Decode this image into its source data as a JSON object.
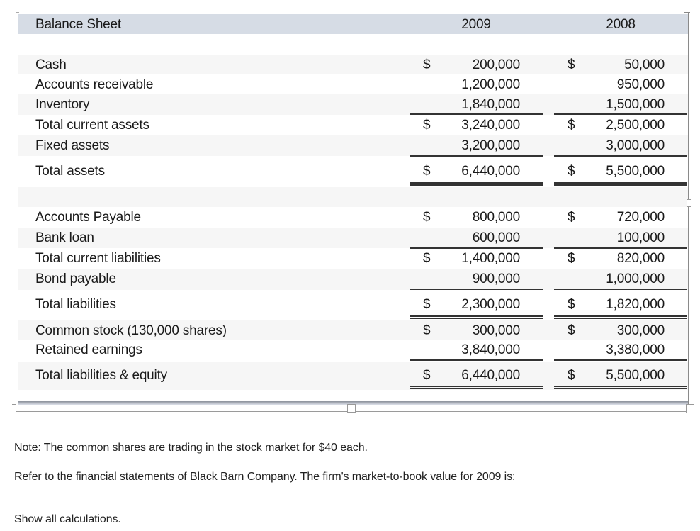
{
  "balance_sheet": {
    "title": "Balance Sheet",
    "years": [
      "2009",
      "2008"
    ],
    "assets": [
      {
        "label": "Cash",
        "y2009": {
          "dollar": "$",
          "value": "200,000"
        },
        "y2008": {
          "dollar": "$",
          "value": "50,000"
        }
      },
      {
        "label": "Accounts receivable",
        "y2009": {
          "dollar": "",
          "value": "1,200,000"
        },
        "y2008": {
          "dollar": "",
          "value": "950,000"
        }
      },
      {
        "label": "Inventory",
        "y2009": {
          "dollar": "",
          "value": "1,840,000"
        },
        "y2008": {
          "dollar": "",
          "value": "1,500,000"
        }
      },
      {
        "label": "Total current assets",
        "y2009": {
          "dollar": "$",
          "value": "3,240,000"
        },
        "y2008": {
          "dollar": "$",
          "value": "2,500,000"
        }
      },
      {
        "label": "Fixed assets",
        "y2009": {
          "dollar": "",
          "value": "3,200,000"
        },
        "y2008": {
          "dollar": "",
          "value": "3,000,000"
        }
      },
      {
        "label": "Total assets",
        "y2009": {
          "dollar": "$",
          "value": "6,440,000"
        },
        "y2008": {
          "dollar": "$",
          "value": "5,500,000"
        }
      }
    ],
    "liabilities_equity": [
      {
        "label": "Accounts Payable",
        "y2009": {
          "dollar": "$",
          "value": "800,000"
        },
        "y2008": {
          "dollar": "$",
          "value": "720,000"
        }
      },
      {
        "label": "Bank loan",
        "y2009": {
          "dollar": "",
          "value": "600,000"
        },
        "y2008": {
          "dollar": "",
          "value": "100,000"
        }
      },
      {
        "label": "Total current liabilities",
        "y2009": {
          "dollar": "$",
          "value": "1,400,000"
        },
        "y2008": {
          "dollar": "$",
          "value": "820,000"
        }
      },
      {
        "label": "Bond payable",
        "y2009": {
          "dollar": "",
          "value": "900,000"
        },
        "y2008": {
          "dollar": "",
          "value": "1,000,000"
        }
      },
      {
        "label": "Total liabilities",
        "y2009": {
          "dollar": "$",
          "value": "2,300,000"
        },
        "y2008": {
          "dollar": "$",
          "value": "1,820,000"
        }
      },
      {
        "label": "Common stock (130,000 shares)",
        "y2009": {
          "dollar": "$",
          "value": "300,000"
        },
        "y2008": {
          "dollar": "$",
          "value": "300,000"
        }
      },
      {
        "label": "Retained earnings",
        "y2009": {
          "dollar": "",
          "value": "3,840,000"
        },
        "y2008": {
          "dollar": "",
          "value": "3,380,000"
        }
      },
      {
        "label": "Total liabilities & equity",
        "y2009": {
          "dollar": "$",
          "value": "6,440,000"
        },
        "y2008": {
          "dollar": "$",
          "value": "5,500,000"
        }
      }
    ]
  },
  "question": {
    "note": "Note: The common shares are trading in the stock market for $40 each.",
    "prompt": "Refer to the financial statements of Black Barn Company. The firm's market-to-book value for 2009 is:",
    "instruction": "Show all calculations."
  }
}
